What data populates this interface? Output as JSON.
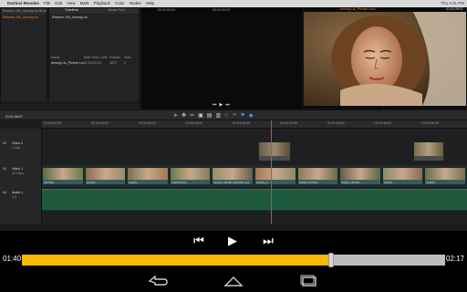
{
  "menubar": {
    "items": [
      "DaVinci Resolve",
      "File",
      "Edit",
      "View",
      "Mark",
      "Playback",
      "Color",
      "Nodes",
      "Help"
    ],
    "clock": "Thu 4:31 PM"
  },
  "media_tree": {
    "title": "Resolve 100_Among Us Browser",
    "item": "Resolve 100_Among Us"
  },
  "media_pool": {
    "tabs": [
      "Timelines",
      "Media Pool"
    ],
    "bin_name": "Resolve 100_Among Us",
    "columns": [
      "Name",
      "Start Time Code",
      "Frames",
      "Start"
    ],
    "row": {
      "name": "Among Us_Picture Lock",
      "tc": "01:00:00:00",
      "frames": "3873",
      "start": "0"
    }
  },
  "viewer_left": {
    "tc_left": "00:00:00:00",
    "tc_mid": "00:00:00:00"
  },
  "viewer_right": {
    "title": "Among Us_Picture Lock",
    "tc": "01:01:28:07"
  },
  "timeline": {
    "timecode": "01:01:28:07",
    "ruler": [
      "01:00:00:00",
      "01:00:15:00",
      "01:00:30:00",
      "01:00:45:00",
      "01:01:00:00",
      "01:01:15:00",
      "01:01:30:00",
      "01:01:45:00",
      "01:02:00:00"
    ],
    "tracks": [
      {
        "id": "V2",
        "name": "Video 2",
        "sub": "1 Clip"
      },
      {
        "id": "V1",
        "name": "Video 1",
        "sub": "12 Clips"
      },
      {
        "id": "A1",
        "name": "Audio 1",
        "sub": "2.0"
      }
    ],
    "clip_labels": [
      "HOTWIR...",
      "GLENN(...",
      "GLENN...",
      "CHATROOM(...",
      "GLENN_OFFSET_BROKEN.mp4",
      "GLENN_D...",
      "GLENN_OFFSET...",
      "GLENN_OFFSET...",
      "GLENN...",
      "GLENN..."
    ]
  },
  "player": {
    "current": "01:40",
    "total": "02:17",
    "progress": 0.73,
    "accent": "#f9b900"
  }
}
